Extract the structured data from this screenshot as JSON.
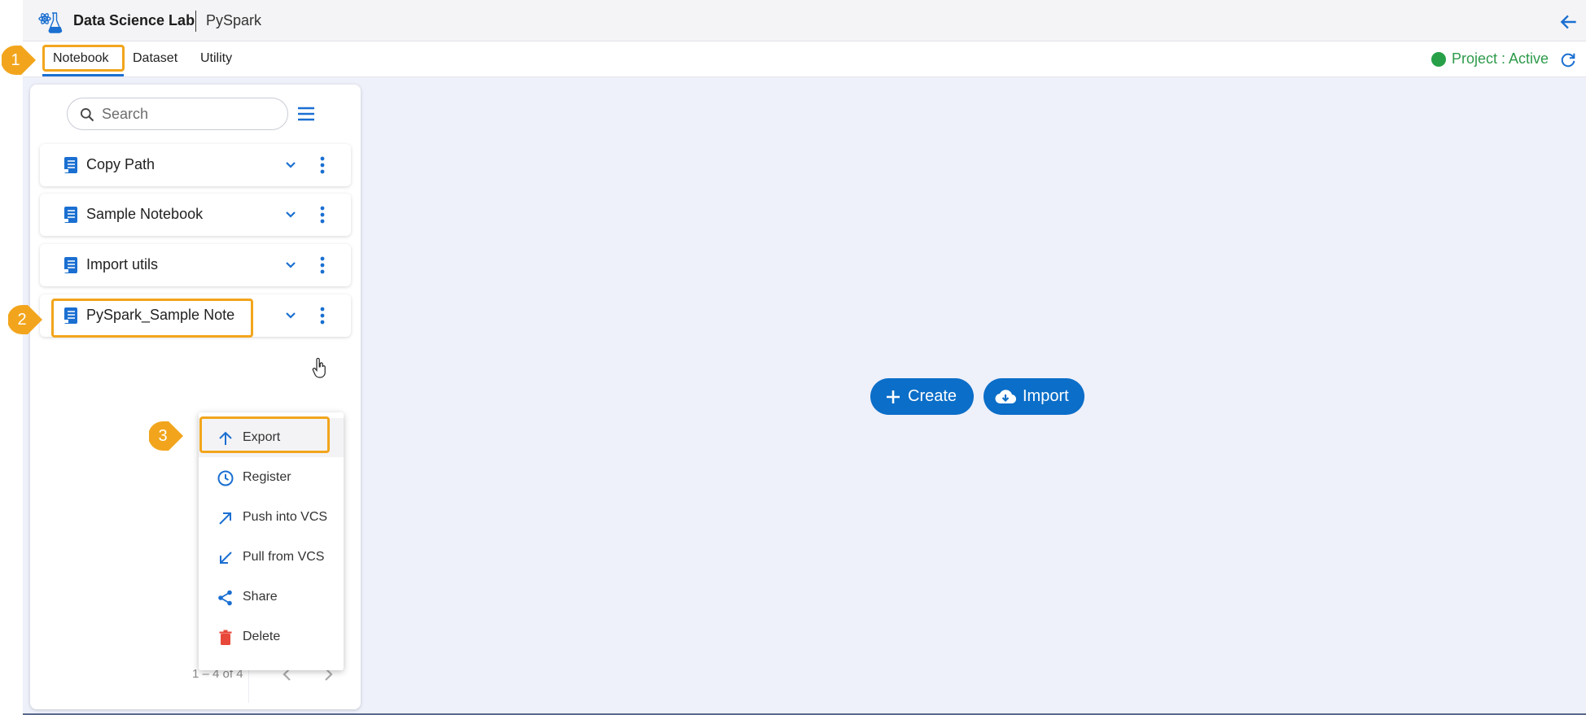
{
  "header": {
    "app_title": "Data Science Lab",
    "sub_title": "PySpark"
  },
  "tabs": [
    {
      "label": "Notebook",
      "active": true
    },
    {
      "label": "Dataset",
      "active": false
    },
    {
      "label": "Utility",
      "active": false
    }
  ],
  "status": {
    "text": "Project : Active",
    "color": "#27a047"
  },
  "search": {
    "placeholder": "Search",
    "value": ""
  },
  "notebooks": [
    {
      "label": "Copy Path"
    },
    {
      "label": "Sample Notebook"
    },
    {
      "label": "Import utils"
    },
    {
      "label": "PySpark_Sample Note"
    }
  ],
  "context_menu": [
    {
      "label": "Export",
      "icon": "arrow-up-icon"
    },
    {
      "label": "Register",
      "icon": "clock-icon"
    },
    {
      "label": "Push into VCS",
      "icon": "arrow-up-right-icon"
    },
    {
      "label": "Pull from VCS",
      "icon": "arrow-down-left-icon"
    },
    {
      "label": "Share",
      "icon": "share-icon"
    },
    {
      "label": "Delete",
      "icon": "trash-icon"
    }
  ],
  "pagination": {
    "text": "1 – 4 of 4"
  },
  "actions": {
    "create_label": "Create",
    "import_label": "Import"
  },
  "annotations": {
    "step1": "1",
    "step2": "2",
    "step3": "3"
  },
  "colors": {
    "primary": "#0b6ec8",
    "highlight": "#f2a51c",
    "delete": "#e8483a",
    "status": "#27a047"
  }
}
